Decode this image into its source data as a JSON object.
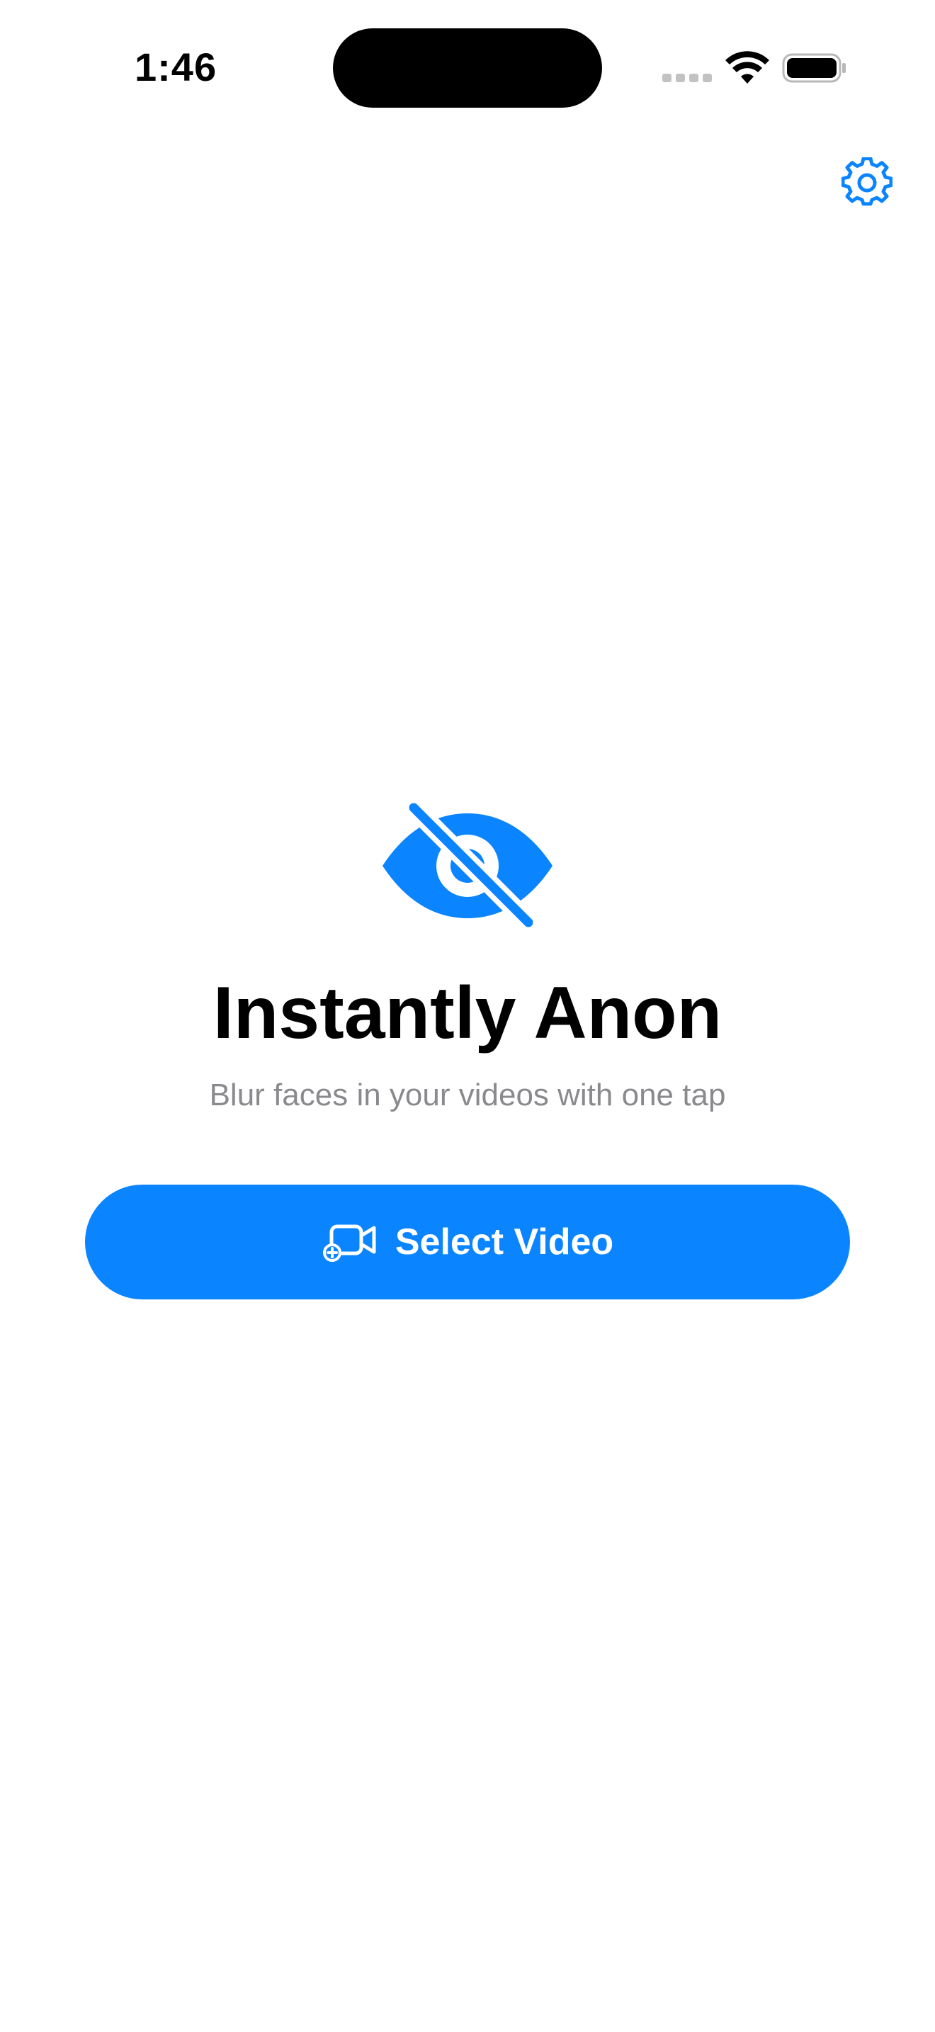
{
  "status_bar": {
    "time": "1:46",
    "icons": [
      "cellular-signal-icon",
      "wifi-icon",
      "battery-icon"
    ]
  },
  "toolbar": {
    "settings_icon": "gear-icon"
  },
  "hero": {
    "icon": "eye-slash-icon",
    "title": "Instantly Anon",
    "subtitle": "Blur faces in your videos with one tap"
  },
  "actions": {
    "select_video_label": "Select Video",
    "select_video_icon": "video-badge-plus-icon"
  },
  "colors": {
    "accent": "#0A84FF",
    "subtitle": "#8A8A8E",
    "background": "#FFFFFF",
    "text": "#000000"
  }
}
